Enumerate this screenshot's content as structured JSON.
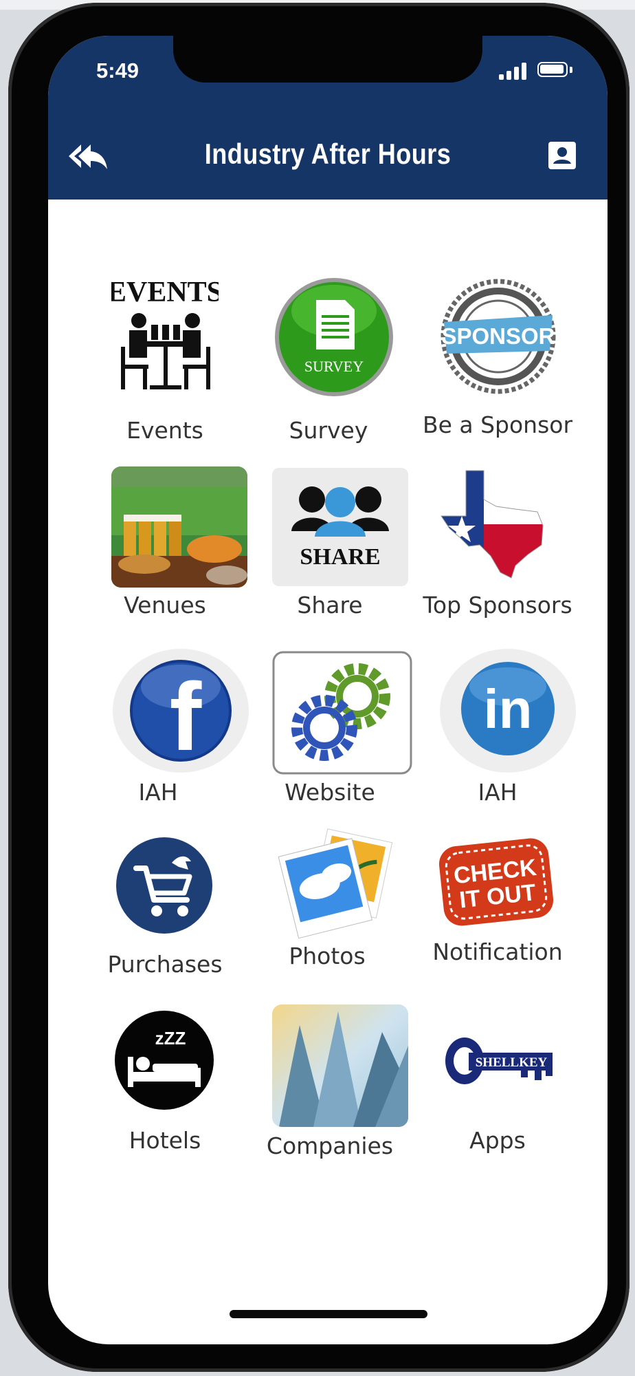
{
  "status_bar": {
    "time": "5:49"
  },
  "header": {
    "title": "Industry After Hours"
  },
  "tiles": [
    {
      "label": "Events",
      "icon": "events-icon",
      "icon_text": "EVENTS"
    },
    {
      "label": "Survey",
      "icon": "survey-icon",
      "icon_text": "SURVEY"
    },
    {
      "label": "Be a Sponsor",
      "icon": "sponsor-stamp-icon",
      "icon_text": "SPONSOR"
    },
    {
      "label": "Venues",
      "icon": "venues-image"
    },
    {
      "label": "Share",
      "icon": "share-icon",
      "icon_text": "SHARE"
    },
    {
      "label": "Top Sponsors",
      "icon": "texas-flag-icon"
    },
    {
      "label": "IAH",
      "icon": "facebook-icon",
      "icon_text": "f"
    },
    {
      "label": "Website",
      "icon": "gears-icon"
    },
    {
      "label": "IAH",
      "icon": "linkedin-icon",
      "icon_text": "in"
    },
    {
      "label": "Purchases",
      "icon": "cart-icon"
    },
    {
      "label": "Photos",
      "icon": "photos-icon"
    },
    {
      "label": "Notification",
      "icon": "check-it-out-icon",
      "icon_text": "CHECK IT OUT"
    },
    {
      "label": "Hotels",
      "icon": "sleeping-bed-icon",
      "icon_text": "zZZ"
    },
    {
      "label": "Companies",
      "icon": "skyscrapers-image"
    },
    {
      "label": "Apps",
      "icon": "shellkey-logo",
      "icon_text": "SHELLKEY"
    }
  ],
  "colors": {
    "header": "#163567",
    "label": "#333333",
    "survey_green": "#2e9a1c",
    "facebook_blue": "#1f4fa8",
    "linkedin_blue": "#2a7bc4",
    "notification_red": "#d33a1a",
    "gear_green": "#5f9a2a",
    "gear_blue": "#2f55b8"
  }
}
